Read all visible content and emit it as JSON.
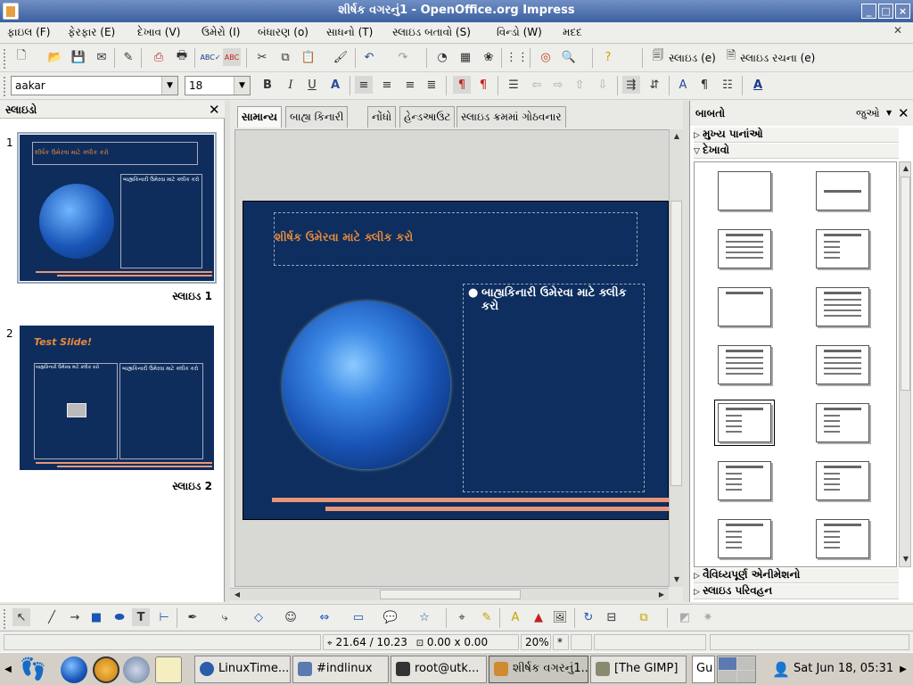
{
  "window": {
    "title": "શીર્ષક વગરનું1 - OpenOffice.org Impress",
    "min": "_",
    "max": "□",
    "close": "×"
  },
  "menu": [
    "ફાઇલ (F)",
    "ફેરફાર (E)",
    "દેખાવ (V)",
    "ઉમેરો (I)",
    "બંધારણ (o)",
    "સાધનો (T)",
    "સ્લાઇડ બતાવો (S)",
    "વિન્ડો (W)",
    "મદદ"
  ],
  "toolbar": {
    "slide_btn": "સ્લાઇડ (e)",
    "slide_design_btn": "સ્લાઇડ રચના (e)"
  },
  "format": {
    "font": "aakar",
    "size": "18"
  },
  "slides_pane": {
    "title": "સ્લાઇડો",
    "slides": [
      {
        "num": "1",
        "label": "સ્લાઇડ 1",
        "title": "શીર્ષક ઉમેરવા માટે ક્લીક કરો",
        "outline": "બાહ્યકિનારી ઉમેરવા માટે ક્લીક કરો"
      },
      {
        "num": "2",
        "label": "સ્લાઇડ 2",
        "title": "Test Slide!",
        "outline": "બાહ્યકિનારી ઉમેરવા માટે ક્લીક કરો",
        "outline2": "બાહ્યકિનારી ઉમેરવા માટે ક્લીક કરો"
      }
    ]
  },
  "tabs": [
    "સામાન્ય",
    "બાહ્ય કિનારી",
    "નોંધો",
    "હેન્ડઆઉટ",
    "સ્લાઇડ ક્રમમાં ગોઠવનાર"
  ],
  "slide": {
    "title_placeholder": "શીર્ષક ઉમેરવા માટે ક્લીક કરો",
    "outline_placeholder": "બાહ્યકિનારી ઉમેરવા માટે ક્લીક કરો"
  },
  "tasks": {
    "title": "બાબતો",
    "view_btn": "જુઓ",
    "sections": {
      "master_pages": "મુખ્ય પાનાંઓ",
      "layouts": "દેખાવો",
      "custom_animation": "વૈવિધ્યપૂર્ણ એનીમેશનો",
      "slide_transition": "સ્લાઇડ પરિવહન"
    },
    "selected_layout_index": 8
  },
  "status": {
    "position": "21.64 / 10.23",
    "size": "0.00 x 0.00",
    "zoom": "20%",
    "star": "*"
  },
  "taskbar": {
    "items": [
      {
        "label": "LinuxTime...",
        "color": "#2a5caa"
      },
      {
        "label": "#indlinux",
        "color": "#5a7ab0"
      },
      {
        "label": "root@utk...",
        "color": "#333333"
      },
      {
        "label": "શીર્ષક વગરનું1...",
        "color": "#d08a30"
      },
      {
        "label": "[The GIMP]",
        "color": "#8a8a70"
      },
      {
        "label": "Gu",
        "color": "#ffffff"
      }
    ],
    "clock": "Sat Jun 18, 05:31"
  },
  "colors": {
    "slide_bg": "#0d2e5e",
    "title_text": "#e88a3c",
    "accent_line": "#e8967a"
  }
}
